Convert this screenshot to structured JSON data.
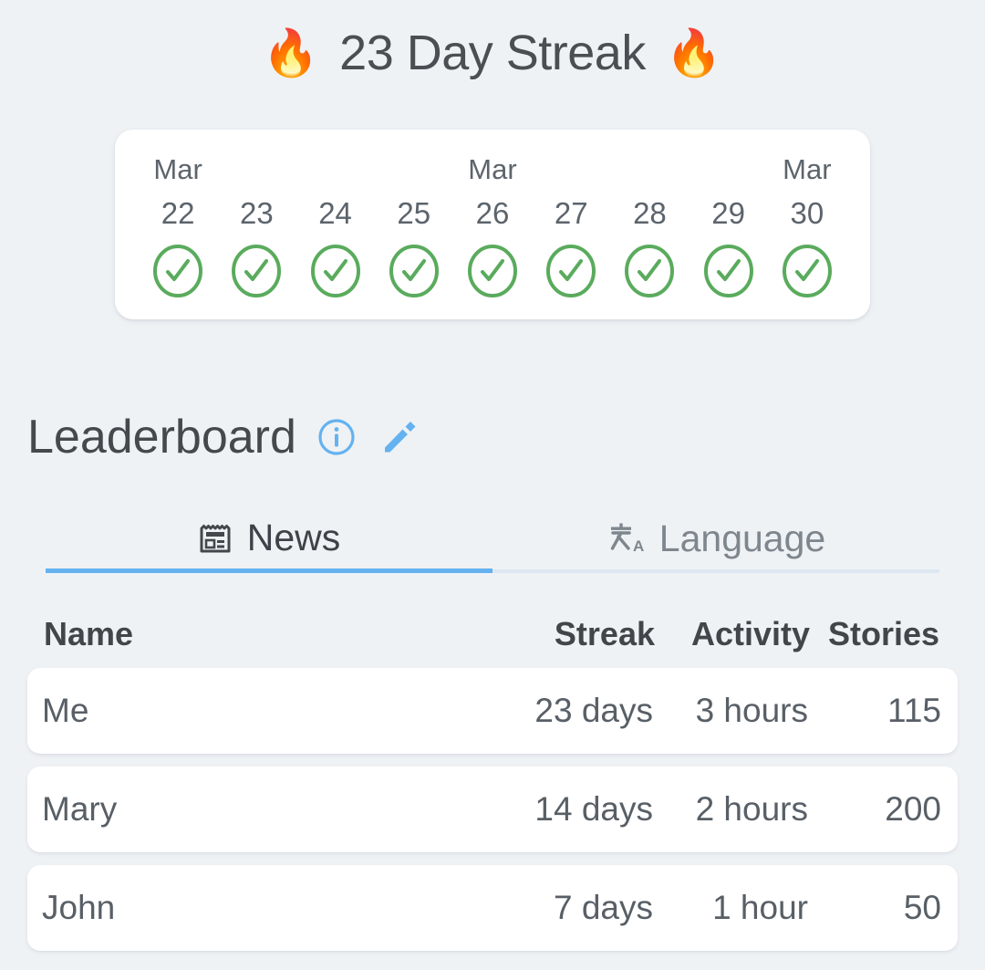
{
  "header": {
    "flame_left": "🔥",
    "flame_right": "🔥",
    "title": "23 Day Streak",
    "streak_days": 23
  },
  "calendar": {
    "days": [
      {
        "month": "Mar",
        "day": "22",
        "completed": true
      },
      {
        "month": "",
        "day": "23",
        "completed": true
      },
      {
        "month": "",
        "day": "24",
        "completed": true
      },
      {
        "month": "",
        "day": "25",
        "completed": true
      },
      {
        "month": "Mar",
        "day": "26",
        "completed": true
      },
      {
        "month": "",
        "day": "27",
        "completed": true
      },
      {
        "month": "",
        "day": "28",
        "completed": true
      },
      {
        "month": "",
        "day": "29",
        "completed": true
      },
      {
        "month": "Mar",
        "day": "30",
        "completed": true
      }
    ]
  },
  "leaderboard": {
    "title": "Leaderboard",
    "info_icon": "info-circle-icon",
    "edit_icon": "pencil-icon",
    "tabs": [
      {
        "label": "News",
        "icon": "newspaper-icon",
        "active": true
      },
      {
        "label": "Language",
        "icon": "translate-icon",
        "active": false
      }
    ],
    "columns": [
      "Name",
      "Streak",
      "Activity",
      "Stories"
    ],
    "rows": [
      {
        "name": "Me",
        "streak": "23 days",
        "activity": "3 hours",
        "stories": "115"
      },
      {
        "name": "Mary",
        "streak": "14 days",
        "activity": "2 hours",
        "stories": "200"
      },
      {
        "name": "John",
        "streak": "7 days",
        "activity": "1 hour",
        "stories": "50"
      }
    ]
  },
  "colors": {
    "background": "#eff2f5",
    "card": "#ffffff",
    "accent_blue": "#64b2f0",
    "check_green": "#5aab5d",
    "text_dark": "#45494e",
    "text_muted": "#5c646c"
  }
}
